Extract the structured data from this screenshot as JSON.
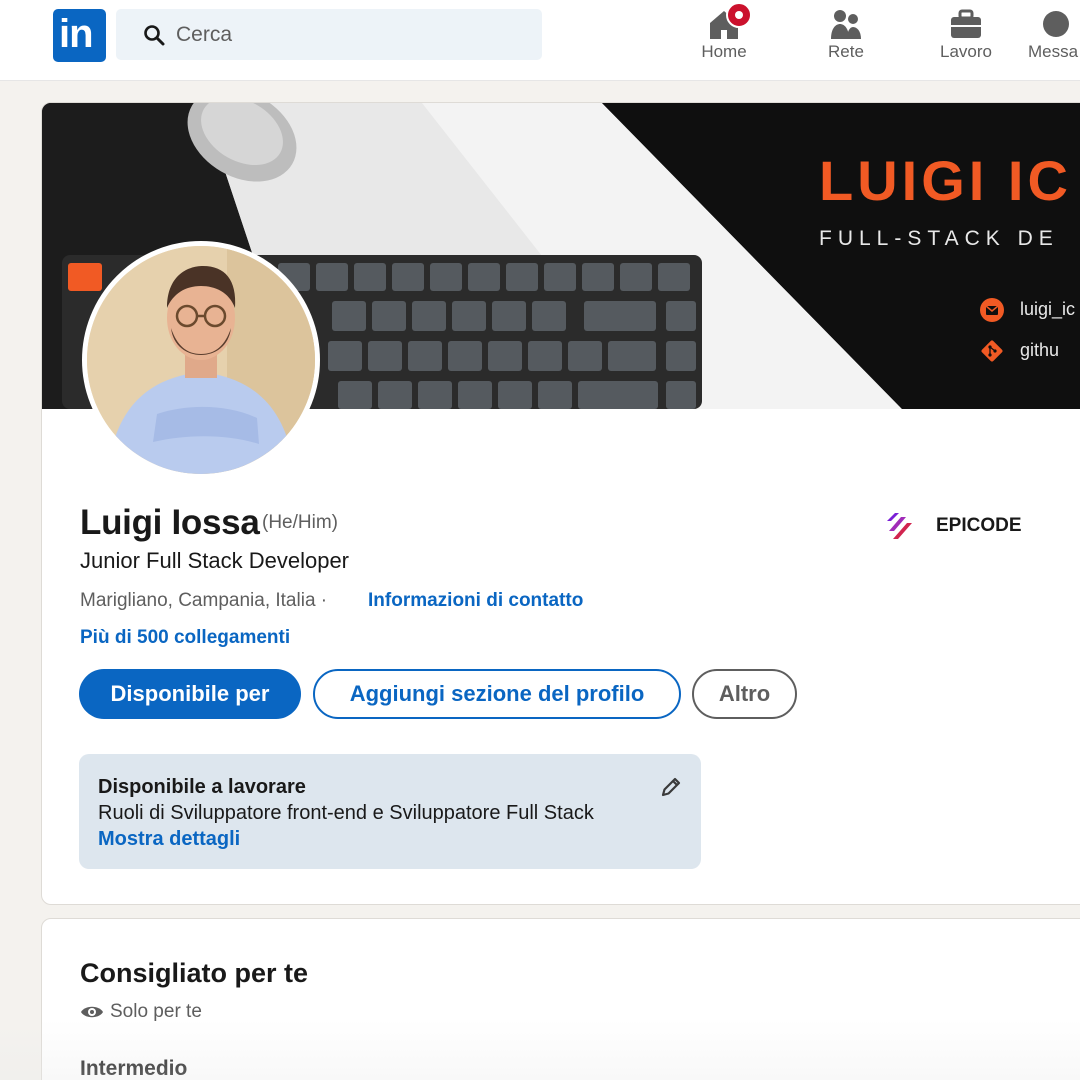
{
  "nav": {
    "logo_text": "in",
    "search": {
      "placeholder": "Cerca"
    },
    "items": [
      {
        "label": "Home",
        "icon": "home-icon",
        "has_notification": true
      },
      {
        "label": "Rete",
        "icon": "people-icon"
      },
      {
        "label": "Lavoro",
        "icon": "briefcase-icon"
      },
      {
        "label": "Messa",
        "icon": "message-icon"
      }
    ]
  },
  "banner": {
    "title": "LUIGI IC",
    "subtitle": "FULL-STACK DE",
    "contacts": [
      {
        "icon": "email-icon",
        "text": "luigi_ic"
      },
      {
        "icon": "git-icon",
        "text": "githu"
      }
    ],
    "accent": "#f15a24"
  },
  "profile": {
    "name": "Luigi Iossa",
    "pronouns": "(He/Him)",
    "headline": "Junior Full Stack Developer",
    "location": "Marigliano, Campania, Italia",
    "separator": "·",
    "contact_link": "Informazioni di contatto",
    "connections": "Più di 500 collegamenti",
    "company": "EPICODE",
    "buttons": {
      "primary": "Disponibile per",
      "add_section": "Aggiungi sezione del profilo",
      "more": "Altro"
    },
    "open_to_work": {
      "title": "Disponibile a lavorare",
      "description": "Ruoli di Sviluppatore front-end e Sviluppatore Full Stack",
      "link": "Mostra dettagli"
    }
  },
  "recommended": {
    "title": "Consigliato per te",
    "visibility": "Solo per te",
    "level": "Intermedio"
  },
  "colors": {
    "brand": "#0a66c2",
    "background": "#f4f2ee",
    "notification": "#cb112d",
    "open_box": "#dde6ee"
  }
}
